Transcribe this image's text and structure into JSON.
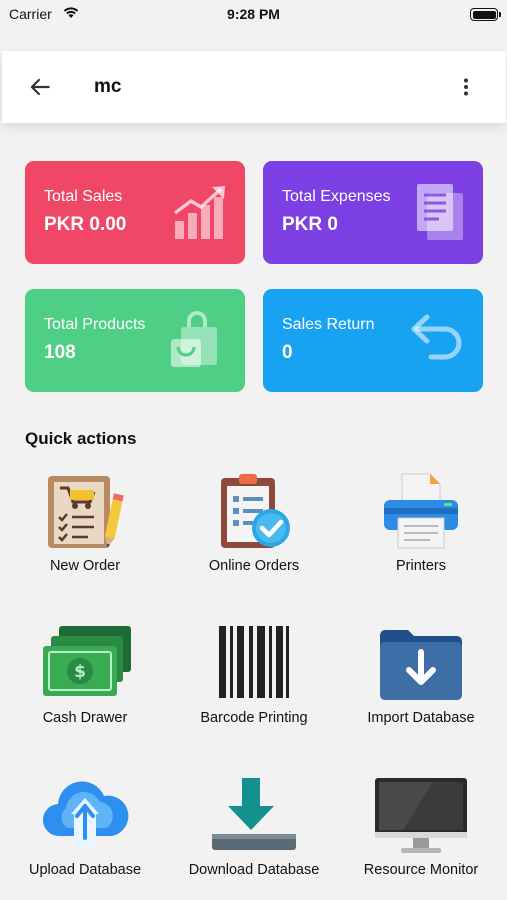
{
  "status_bar": {
    "carrier": "Carrier",
    "time": "9:28 PM"
  },
  "app_bar": {
    "title": "mc",
    "back_icon": "arrow-left-icon",
    "menu_icon": "more-vertical-icon"
  },
  "stats": [
    {
      "label": "Total Sales",
      "value": "PKR 0.00",
      "color": "#f04766",
      "icon": "chart-growth-icon"
    },
    {
      "label": "Total Expenses",
      "value": "PKR 0",
      "color": "#7b3fe4",
      "icon": "documents-icon"
    },
    {
      "label": "Total Products",
      "value": "108",
      "color": "#4fcf85",
      "icon": "shopping-bag-icon"
    },
    {
      "label": "Sales Return",
      "value": "0",
      "color": "#18a3f2",
      "icon": "return-arrow-icon"
    }
  ],
  "quick_actions": {
    "title": "Quick actions",
    "items": [
      {
        "label": "New Order",
        "icon": "order-list-icon"
      },
      {
        "label": "Online Orders",
        "icon": "clipboard-check-icon"
      },
      {
        "label": "Printers",
        "icon": "printer-icon"
      },
      {
        "label": "Cash Drawer",
        "icon": "cash-icon"
      },
      {
        "label": "Barcode Printing",
        "icon": "barcode-icon"
      },
      {
        "label": "Import Database",
        "icon": "import-folder-icon"
      },
      {
        "label": "Upload Database",
        "icon": "cloud-upload-icon"
      },
      {
        "label": "Download Database",
        "icon": "download-icon"
      },
      {
        "label": "Resource Monitor",
        "icon": "monitor-icon"
      }
    ]
  }
}
